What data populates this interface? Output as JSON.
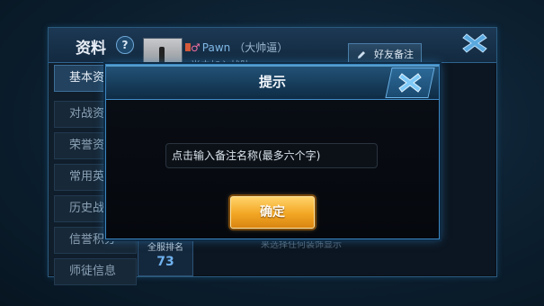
{
  "profile": {
    "title": "资料",
    "help_label": "?",
    "player_name": "Pawn",
    "gender_symbol": "♂",
    "nickname": "（大帅逼）",
    "status": "尚未加入战队",
    "remark_button": "好友备注",
    "sidebar": {
      "items": [
        {
          "label": "基本资料",
          "active": true
        },
        {
          "label": "对战资料",
          "active": false
        },
        {
          "label": "荣誉资料",
          "active": false
        },
        {
          "label": "常用英雄",
          "active": false
        },
        {
          "label": "历史战绩",
          "active": false
        },
        {
          "label": "信誉积分",
          "active": false
        },
        {
          "label": "师徒信息",
          "active": false
        }
      ]
    },
    "rank": {
      "label": "全服排名",
      "value": "73"
    },
    "hint": "来选择任何装饰显示"
  },
  "dialog": {
    "title": "提示",
    "input_placeholder": "点击输入备注名称(最多六个字)",
    "confirm_label": "确定"
  },
  "colors": {
    "accent_blue": "#3b86c0",
    "confirm_gold": "#f2a623",
    "close_icon": "#6fc3f5"
  }
}
